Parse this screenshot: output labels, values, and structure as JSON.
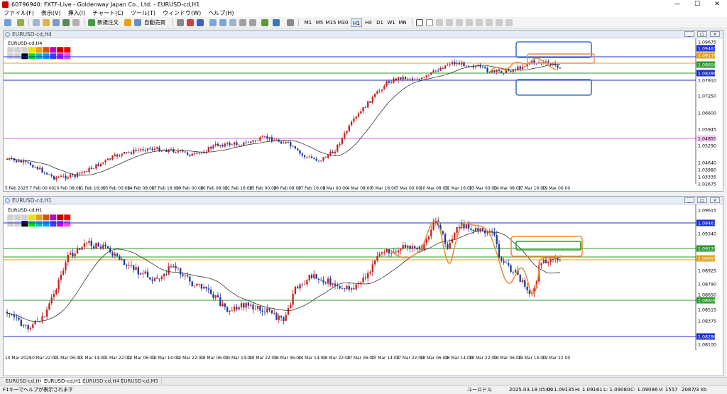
{
  "app": {
    "title": "60796940: FXTF-Live - Goldenway Japan Co., Ltd. - EURUSD-cd,H1",
    "controls": {
      "minimize": "—",
      "maximize": "☐",
      "close": "✕"
    }
  },
  "menu": [
    "ファイル(F)",
    "表示(V)",
    "挿入(I)",
    "チャート(C)",
    "ツール(T)",
    "ウィンドウ(W)",
    "ヘルプ(H)"
  ],
  "toolbar": {
    "new_order": "新規注文",
    "auto_trade": "自動売買",
    "timeframes": [
      "M1",
      "M5",
      "M15",
      "M30",
      "H1",
      "H4",
      "D1",
      "W1",
      "MN"
    ],
    "active_timeframe": "H1"
  },
  "chart_top": {
    "caption": "EURUSD-cd,H4",
    "symbol_label": "EURUSD-cd,H4",
    "price_labels": [
      "1.09675",
      "1.09463",
      "1.09135",
      "1.08606",
      "1.08286",
      "1.07910",
      "1.07250",
      "1.06600",
      "1.05945",
      "1.05290",
      "1.04855",
      "1.04640",
      "1.03980",
      "1.03335",
      "1.02675"
    ],
    "time_labels": [
      "5 Feb 2025",
      "7 Feb 00:00",
      "10 Feb 08:00",
      "11 Feb 16:00",
      "13 Feb 00:00",
      "14 Feb 08:00",
      "17 Feb 16:00",
      "19 Feb 00:00",
      "20 Feb 08:00",
      "21 Feb 16:00",
      "25 Feb 00:00",
      "26 Feb 08:00",
      "27 Feb 16:00",
      "3 Mar 00:00",
      "4 Mar 08:00",
      "5 Mar 16:00",
      "7 Mar 00:00",
      "10 Mar 08:00",
      "11 Mar 16:00",
      "13 Mar 00:00",
      "14 Mar 08:00",
      "17 Mar 16:00",
      "19 Mar 00:00"
    ]
  },
  "chart_bottom": {
    "caption": "EURUSD-cd,H1",
    "symbol_label": "EURUSD-cd,H1",
    "price_labels": [
      "1.09615",
      "1.09463",
      "1.09340",
      "1.09135",
      "1.09055",
      "1.08925",
      "1.08790",
      "1.08650",
      "1.08606",
      "1.08515",
      "1.08375",
      "1.08286",
      "1.08100"
    ],
    "time_labels": [
      "10 Mar 2025",
      "10 Mar 22:00",
      "11 Mar 06:00",
      "11 Mar 14:00",
      "11 Mar 22:00",
      "12 Mar 06:00",
      "12 Mar 14:00",
      "12 Mar 22:00",
      "13 Mar 06:00",
      "13 Mar 14:00",
      "13 Mar 22:00",
      "14 Mar 06:00",
      "14 Mar 14:00",
      "14 Mar 22:00",
      "17 Mar 06:00",
      "17 Mar 14:00",
      "17 Mar 22:00",
      "18 Mar 06:00",
      "18 Mar 14:00",
      "18 Mar 22:00",
      "19 Mar 06:00",
      "19 Mar 14:00",
      "19 Mar 22:00"
    ]
  },
  "tabs": [
    "EURUSD-cd,H4",
    "EURUSD-cd,H1",
    "EURUSD-cd,H4",
    "EURUSD-cd,M5"
  ],
  "active_tab": 1,
  "status": {
    "help": "F1キーでヘルプが表示されます",
    "profile": "ユーロドル",
    "datetime": "2025.03.18 05:00",
    "open": "O: 1.09135",
    "high": "H: 1.09161",
    "low": "L: 1.09080",
    "close": "C: 1.09086",
    "volume": "V: 1557",
    "traffic": "2087/3 kb"
  },
  "colors": {
    "bull": "#c8201c",
    "bear": "#1f3a99",
    "ma": "#333333",
    "resistance": "#1c2fd1",
    "support": "#2a9a2a",
    "mid": "#e0a020",
    "magenta": "#e060e0",
    "highlight": "#ee8c3a",
    "box_blue": "#3a74c0"
  }
}
